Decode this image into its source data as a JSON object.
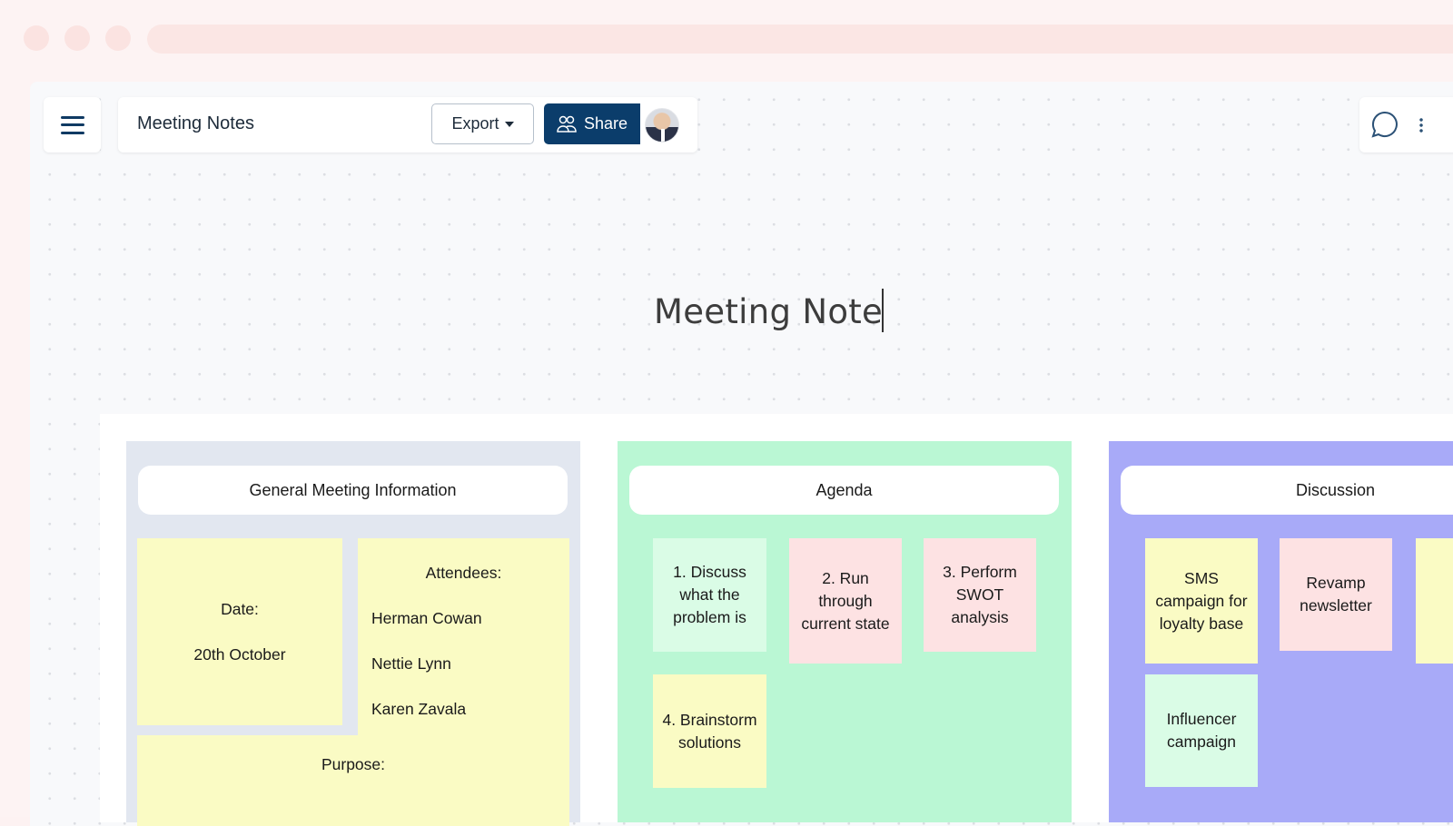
{
  "header": {
    "doc_title": "Meeting Notes",
    "export_label": "Export",
    "share_label": "Share",
    "icons": {
      "menu": "hamburger-menu-icon",
      "share": "users-icon",
      "comments": "chat-bubble-icon",
      "more": "more-vertical-icon",
      "export_caret": "caret-down-icon"
    }
  },
  "canvas": {
    "heading": "Meeting Note"
  },
  "colors": {
    "brand": "#0b3d6b",
    "general_bg": "#e2e7f0",
    "agenda_bg": "#baf7d4",
    "discussion_bg": "#a8aaf8",
    "note_yellow": "#fafbc4",
    "note_pink": "#fde2e3",
    "note_mint": "#dafce6"
  },
  "sections": {
    "general": {
      "title": "General Meeting Information",
      "date_label": "Date:",
      "date_value": "20th October",
      "attendees_label": "Attendees:",
      "attendees": [
        "Herman Cowan",
        "Nettie Lynn",
        "Karen Zavala"
      ],
      "purpose_label": "Purpose:"
    },
    "agenda": {
      "title": "Agenda",
      "items": [
        {
          "text": "1. Discuss what the problem is",
          "color": "mint"
        },
        {
          "text": "2. Run through current state",
          "color": "pink"
        },
        {
          "text": "3. Perform SWOT analysis",
          "color": "pink"
        },
        {
          "text": "4. Brainstorm solutions",
          "color": "yellow"
        }
      ]
    },
    "discussion": {
      "title": "Discussion",
      "items": [
        {
          "text": "SMS campaign for loyalty base",
          "color": "yellow"
        },
        {
          "text": "Revamp newsletter",
          "color": "pink"
        },
        {
          "text": "",
          "color": "yellow"
        },
        {
          "text": "Influencer campaign",
          "color": "mint"
        }
      ]
    }
  }
}
